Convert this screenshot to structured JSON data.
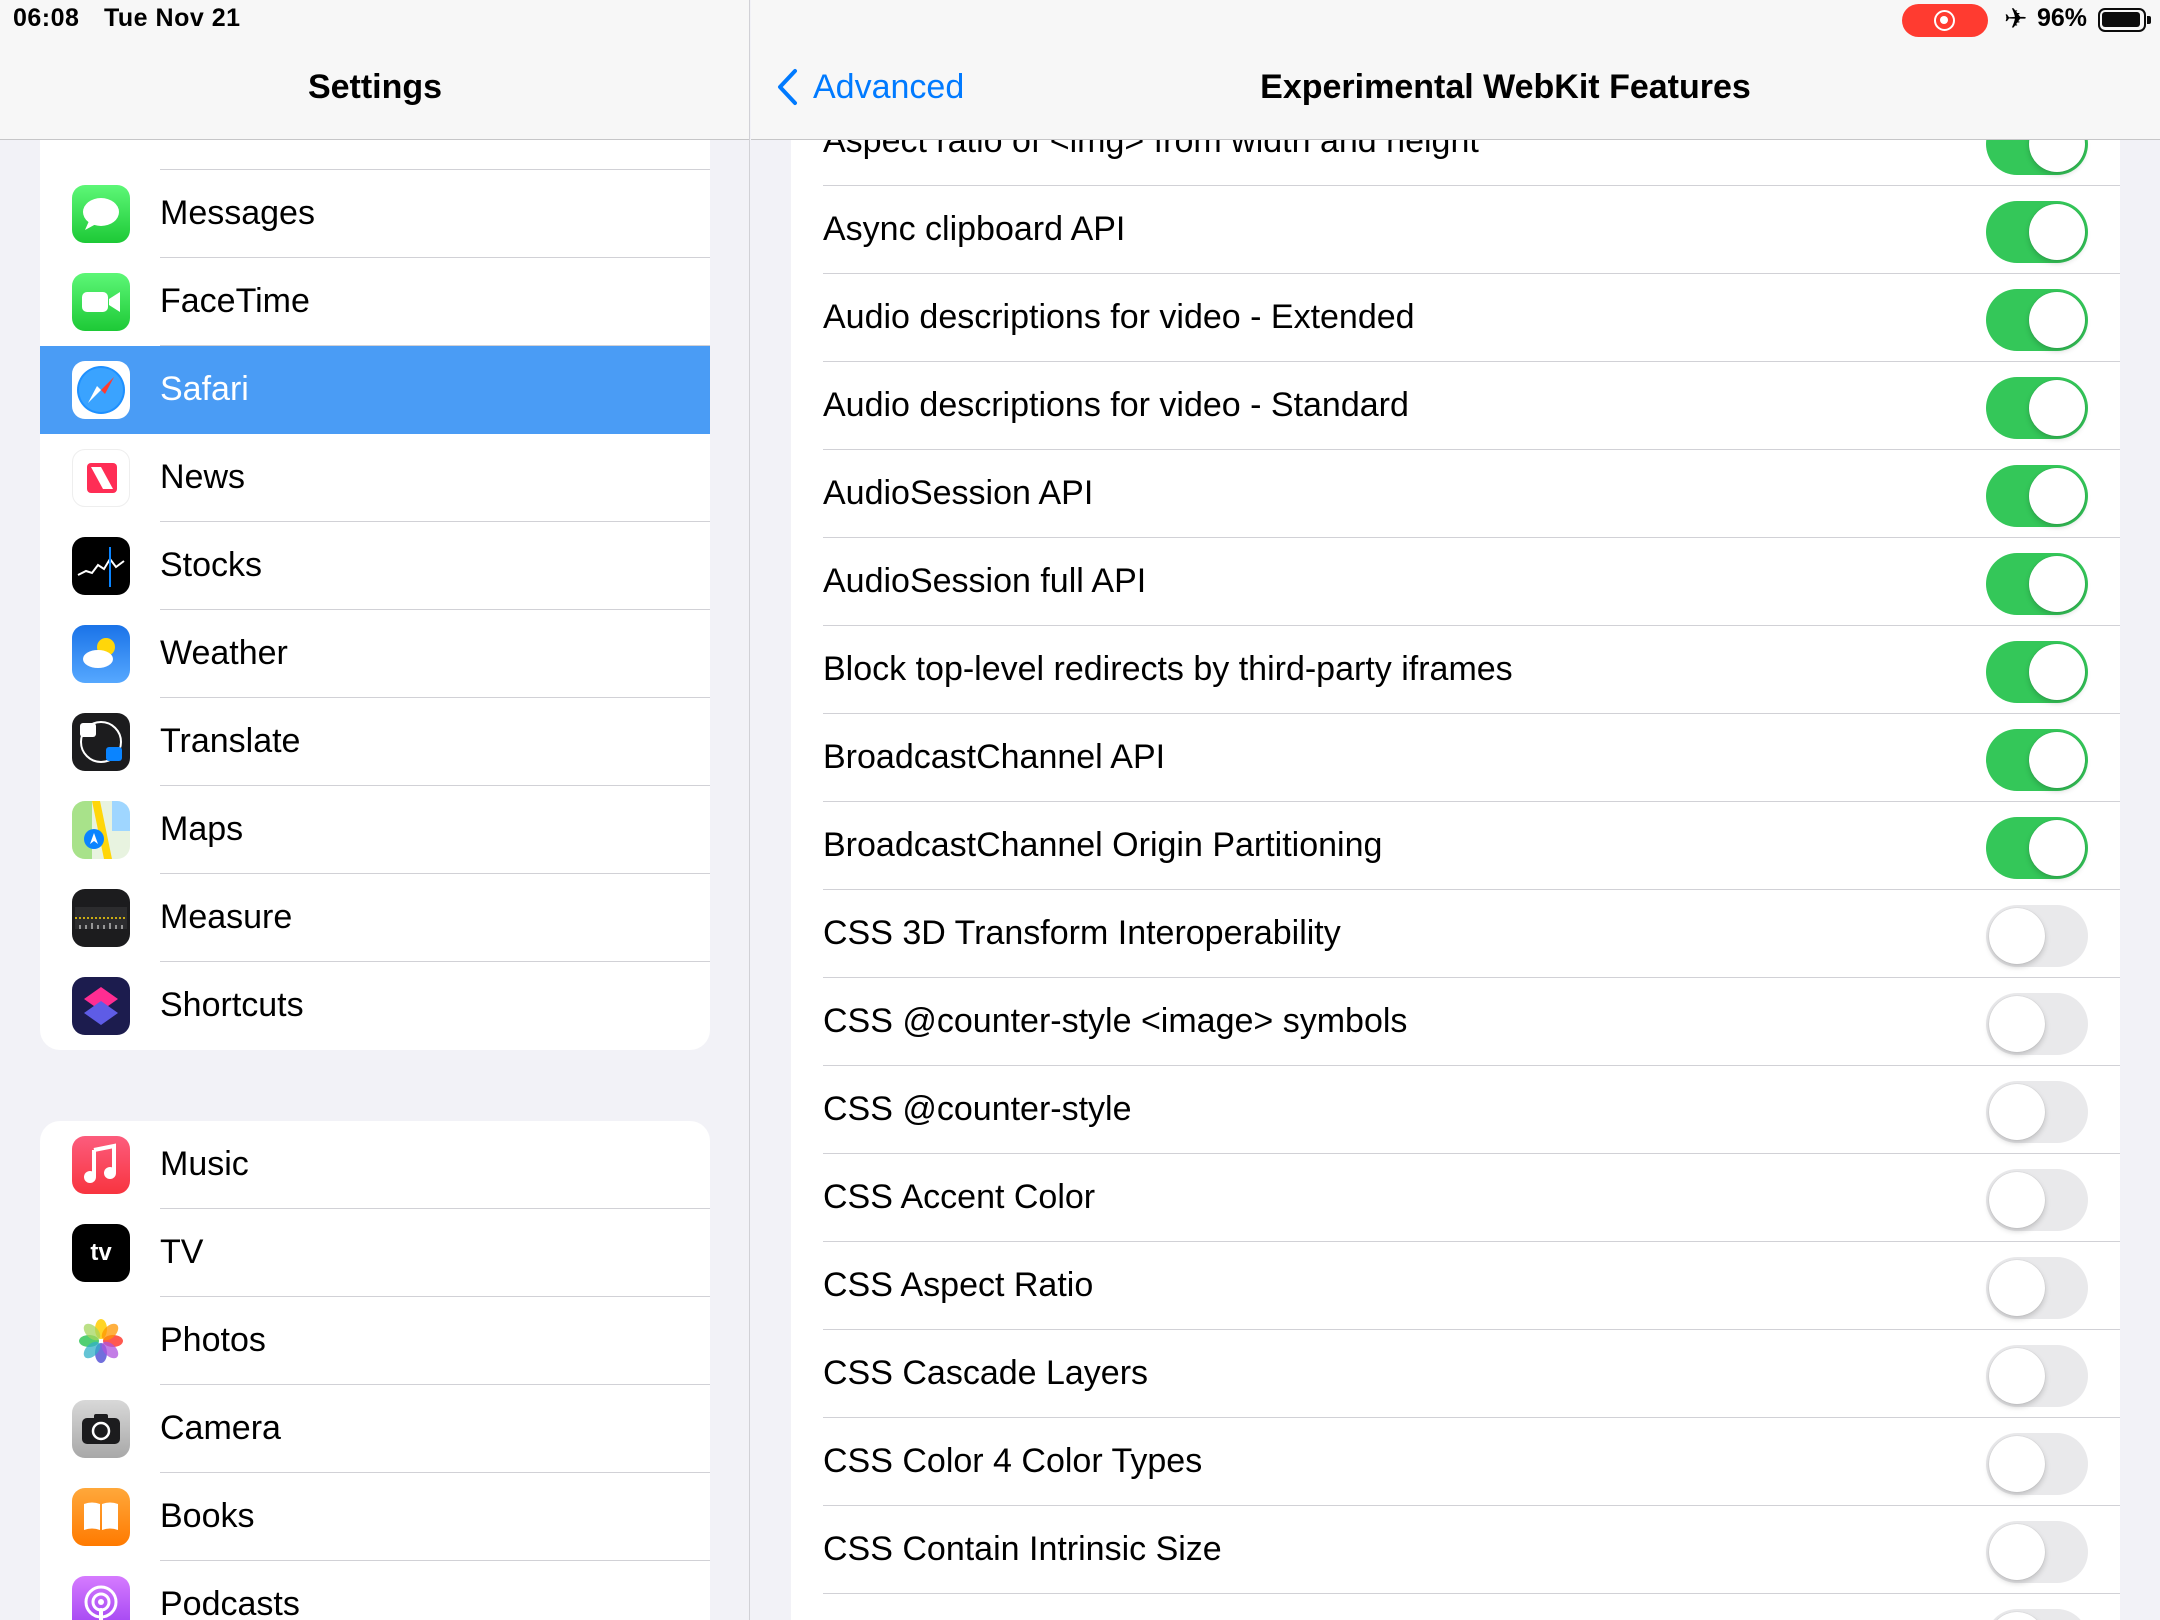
{
  "status_bar": {
    "time": "06:08",
    "date": "Tue Nov 21",
    "battery_percent": "96%",
    "airplane_glyph": "✈",
    "battery_level": 0.96
  },
  "sidebar": {
    "title": "Settings",
    "group1": [
      {
        "label": "Messages",
        "icon": "messages-icon"
      },
      {
        "label": "FaceTime",
        "icon": "facetime-icon"
      },
      {
        "label": "Safari",
        "icon": "safari-icon",
        "selected": true
      },
      {
        "label": "News",
        "icon": "news-icon"
      },
      {
        "label": "Stocks",
        "icon": "stocks-icon"
      },
      {
        "label": "Weather",
        "icon": "weather-icon"
      },
      {
        "label": "Translate",
        "icon": "translate-icon"
      },
      {
        "label": "Maps",
        "icon": "maps-icon"
      },
      {
        "label": "Measure",
        "icon": "measure-icon"
      },
      {
        "label": "Shortcuts",
        "icon": "shortcuts-icon"
      }
    ],
    "group2": [
      {
        "label": "Music",
        "icon": "music-icon"
      },
      {
        "label": "TV",
        "icon": "tv-icon"
      },
      {
        "label": "Photos",
        "icon": "photos-icon"
      },
      {
        "label": "Camera",
        "icon": "camera-icon"
      },
      {
        "label": "Books",
        "icon": "books-icon"
      },
      {
        "label": "Podcasts",
        "icon": "podcasts-icon"
      }
    ]
  },
  "detail": {
    "back_label": "Advanced",
    "title": "Experimental WebKit Features",
    "features": [
      {
        "label": "Aspect ratio of <img> from width and height",
        "on": true
      },
      {
        "label": "Async clipboard API",
        "on": true
      },
      {
        "label": "Audio descriptions for video - Extended",
        "on": true
      },
      {
        "label": "Audio descriptions for video - Standard",
        "on": true
      },
      {
        "label": "AudioSession API",
        "on": true
      },
      {
        "label": "AudioSession full API",
        "on": true
      },
      {
        "label": "Block top-level redirects by third-party iframes",
        "on": true
      },
      {
        "label": "BroadcastChannel API",
        "on": true
      },
      {
        "label": "BroadcastChannel Origin Partitioning",
        "on": true
      },
      {
        "label": "CSS 3D Transform Interoperability",
        "on": false
      },
      {
        "label": "CSS @counter-style <image> symbols",
        "on": false
      },
      {
        "label": "CSS @counter-style",
        "on": false
      },
      {
        "label": "CSS Accent Color",
        "on": false
      },
      {
        "label": "CSS Aspect Ratio",
        "on": false
      },
      {
        "label": "CSS Cascade Layers",
        "on": false
      },
      {
        "label": "CSS Color 4 Color Types",
        "on": false
      },
      {
        "label": "CSS Contain Intrinsic Size",
        "on": false
      },
      {
        "label": "",
        "on": false
      }
    ]
  },
  "colors": {
    "accent": "#007aff",
    "toggle_on": "#34c759",
    "selection": "#4a9cf5",
    "record": "#ff3b30"
  }
}
